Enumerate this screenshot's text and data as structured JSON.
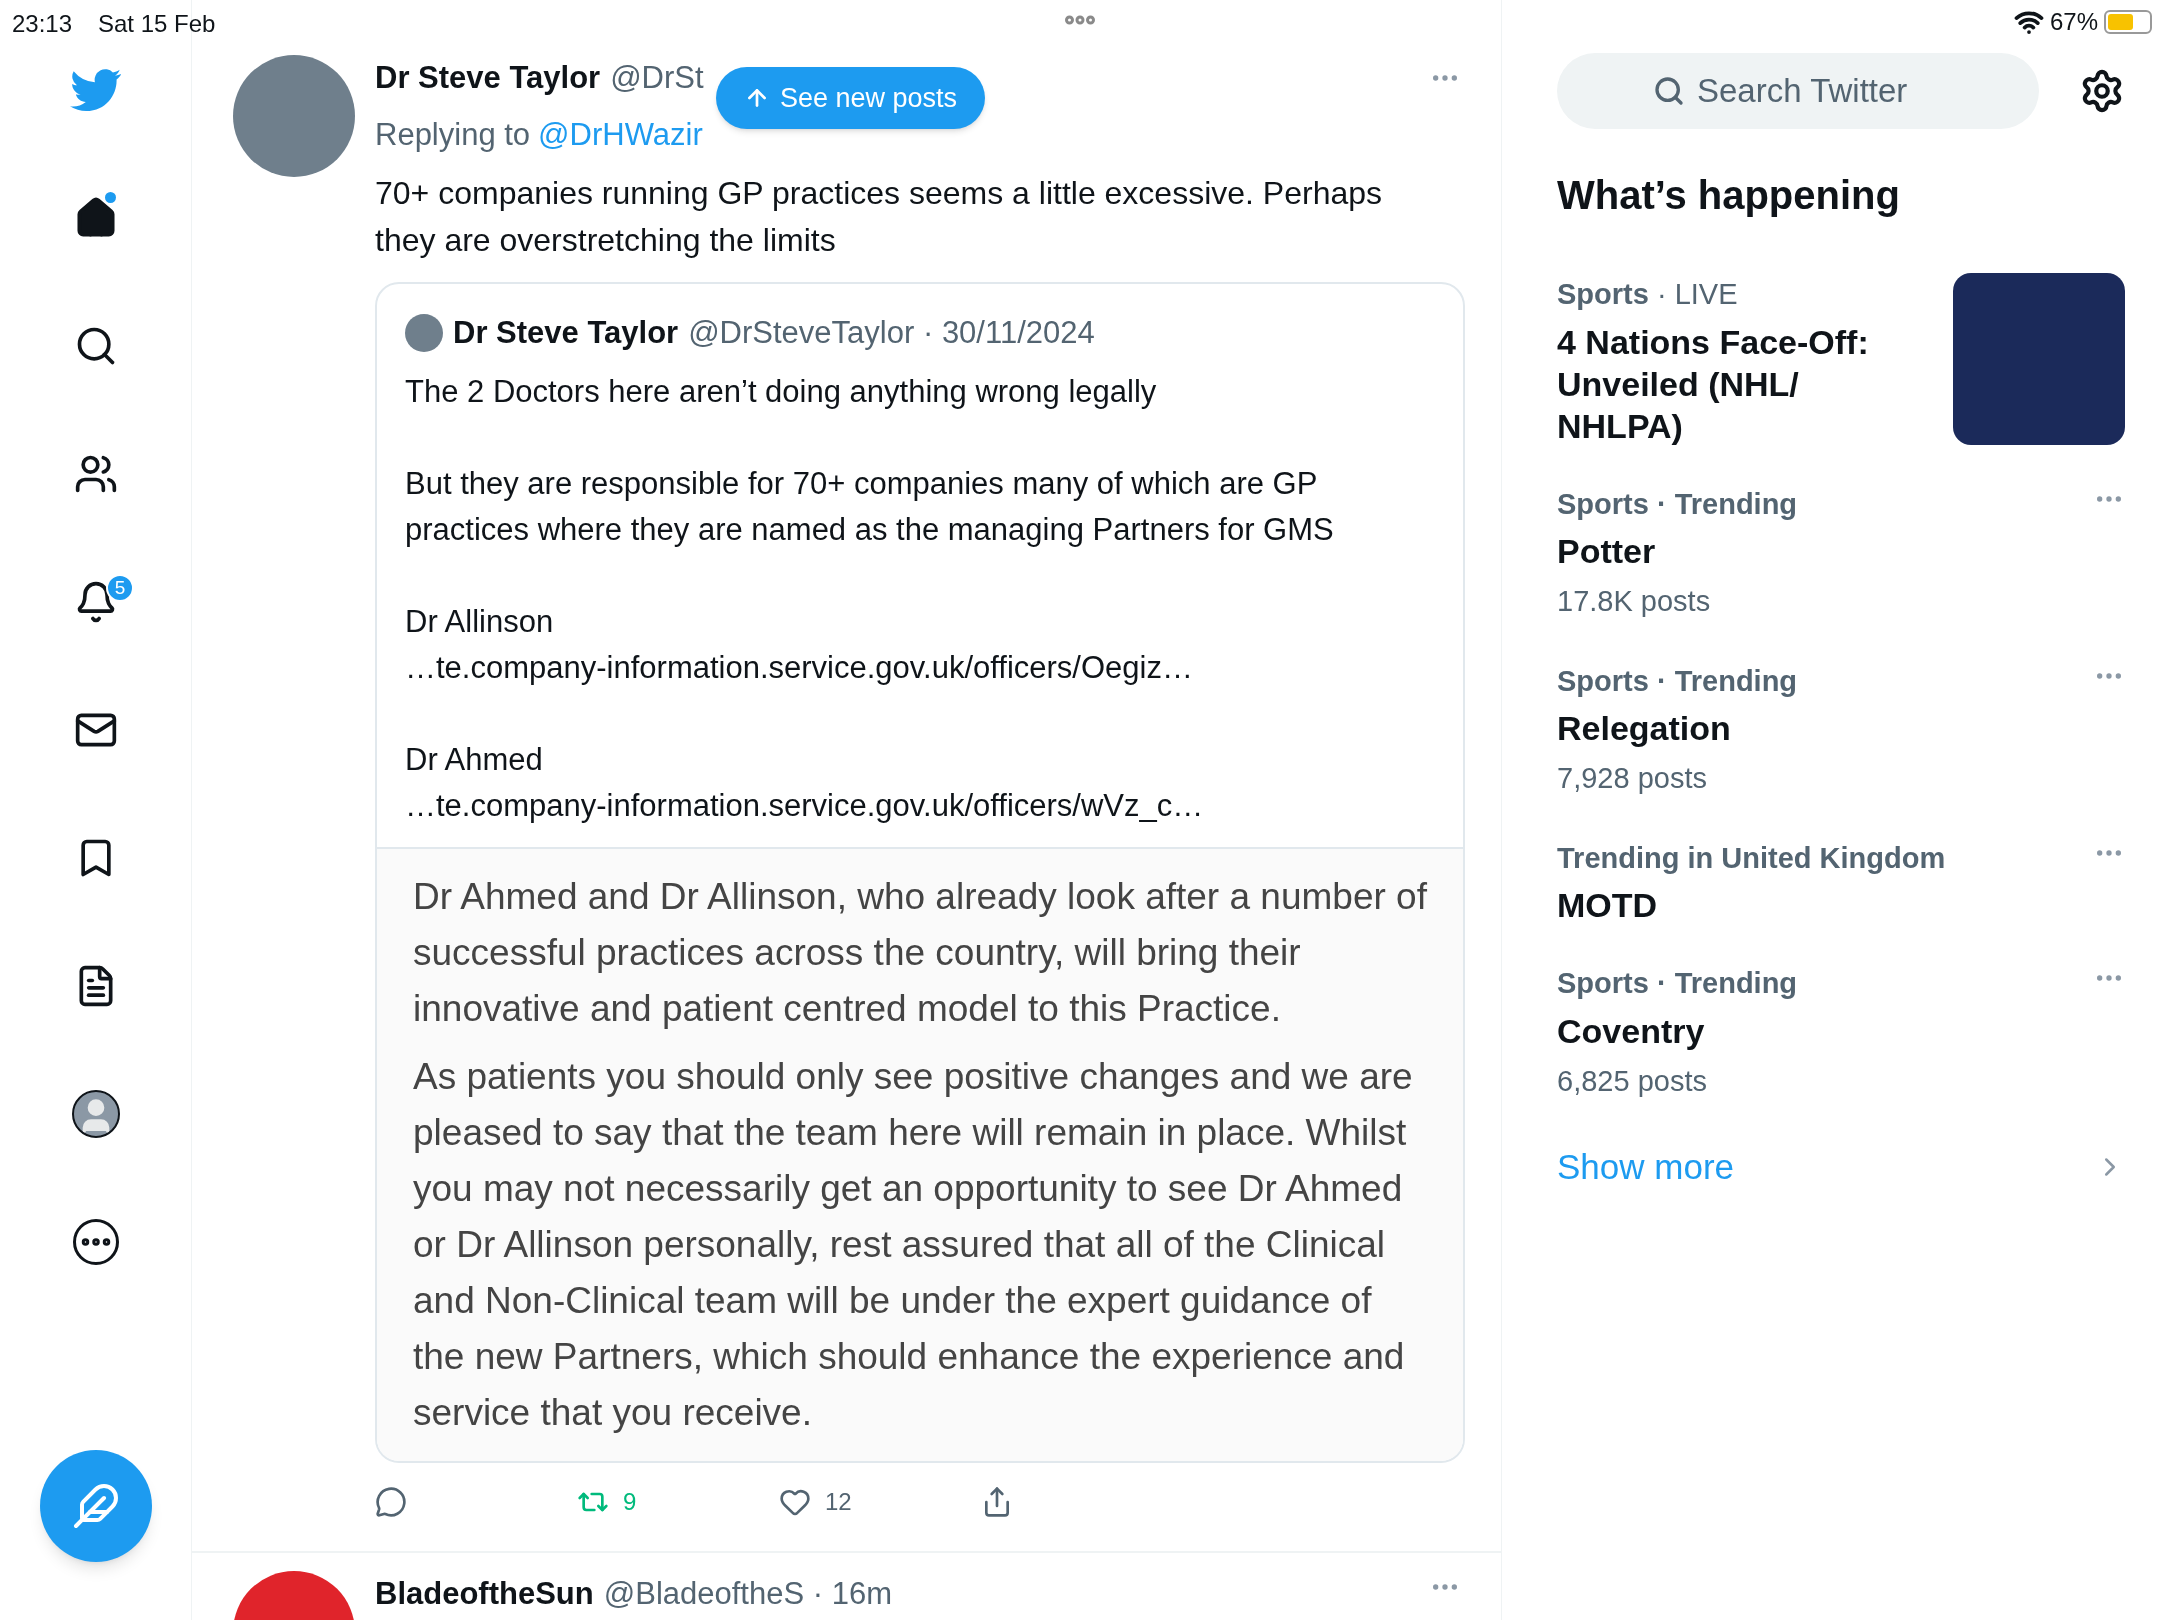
{
  "status_bar": {
    "time": "23:13",
    "date": "Sat 15 Feb",
    "battery": "67%"
  },
  "sidebar": {
    "items": [
      {
        "kind": "logo",
        "unread": false
      },
      {
        "kind": "home",
        "unread": true
      },
      {
        "kind": "explore",
        "unread": false
      },
      {
        "kind": "communities",
        "unread": false
      },
      {
        "kind": "notifications",
        "unread": false,
        "badge": "5"
      },
      {
        "kind": "messages",
        "unread": false
      },
      {
        "kind": "bookmarks",
        "unread": false
      },
      {
        "kind": "lists",
        "unread": false
      },
      {
        "kind": "profile",
        "unread": false
      },
      {
        "kind": "more",
        "unread": false
      }
    ]
  },
  "new_posts_button": "See new posts",
  "tweet": {
    "author": "Dr Steve Taylor",
    "handle": "@DrSt",
    "replying_label": "Replying to",
    "reply_to": "@DrHWazir",
    "text": "70+ companies running GP practices seems a little excessive. Perhaps they are overstretching the limits",
    "quote": {
      "author": "Dr Steve Taylor",
      "handle": "@DrSteveTaylor",
      "separator": "·",
      "date": "30/11/2024",
      "paragraphs": [
        {
          "text": "The 2 Doctors here aren’t doing anything wrong legally"
        },
        {
          "text": "But they are responsible for 70+ companies many of which are GP practices where they are named as the managing Partners for GMS"
        },
        {
          "text": "Dr Allinson",
          "link": "…te.company-information.service.gov.uk/officers/Oegiz…"
        },
        {
          "text": "Dr Ahmed",
          "link": "…te.company-information.service.gov.uk/officers/wVz_c…"
        }
      ],
      "document_paragraphs": [
        "Dr Ahmed and Dr Allinson, who already look after a number of successful practices across the country, will bring their innovative and patient centred model to this Practice.",
        "As patients you should only see positive changes and we are pleased to say that the team here will remain in place. Whilst you may not necessarily get an opportunity to see Dr Ahmed or Dr Allinson personally, rest assured that all of the Clinical and Non-Clinical team will be under the expert guidance of the new Partners, which should enhance the experience and service that you receive."
      ]
    },
    "actions": [
      {
        "kind": "reply",
        "active": false
      },
      {
        "kind": "retweet",
        "count": "9",
        "active": true
      },
      {
        "kind": "like",
        "count": "12",
        "active": false
      },
      {
        "kind": "share",
        "active": false
      }
    ]
  },
  "next_tweet": {
    "author": "BladeoftheSun",
    "handle": "@BladeoftheS",
    "separator": "·",
    "time": "16m"
  },
  "right_panel": {
    "search": {
      "placeholder": "Search Twitter"
    },
    "heading": "What’s happening",
    "trends": [
      {
        "kind": "image",
        "category": "Sports",
        "separator": "·",
        "meta": "LIVE",
        "title": "4 Nations Face-Off: Unveiled (NHL/ NHLPA)"
      },
      {
        "kind": "plain",
        "category": "Sports",
        "separator": "·",
        "meta": "Trending",
        "title": "Potter",
        "count": "17.8K posts"
      },
      {
        "kind": "plain",
        "category": "Sports",
        "separator": "·",
        "meta": "Trending",
        "title": "Relegation",
        "count": "7,928 posts"
      },
      {
        "kind": "plain",
        "category": "Trending in United Kingdom",
        "title": "MOTD"
      },
      {
        "kind": "plain",
        "category": "Sports",
        "separator": "·",
        "meta": "Trending",
        "title": "Coventry",
        "count": "6,825 posts"
      }
    ],
    "show_more": "Show more"
  }
}
